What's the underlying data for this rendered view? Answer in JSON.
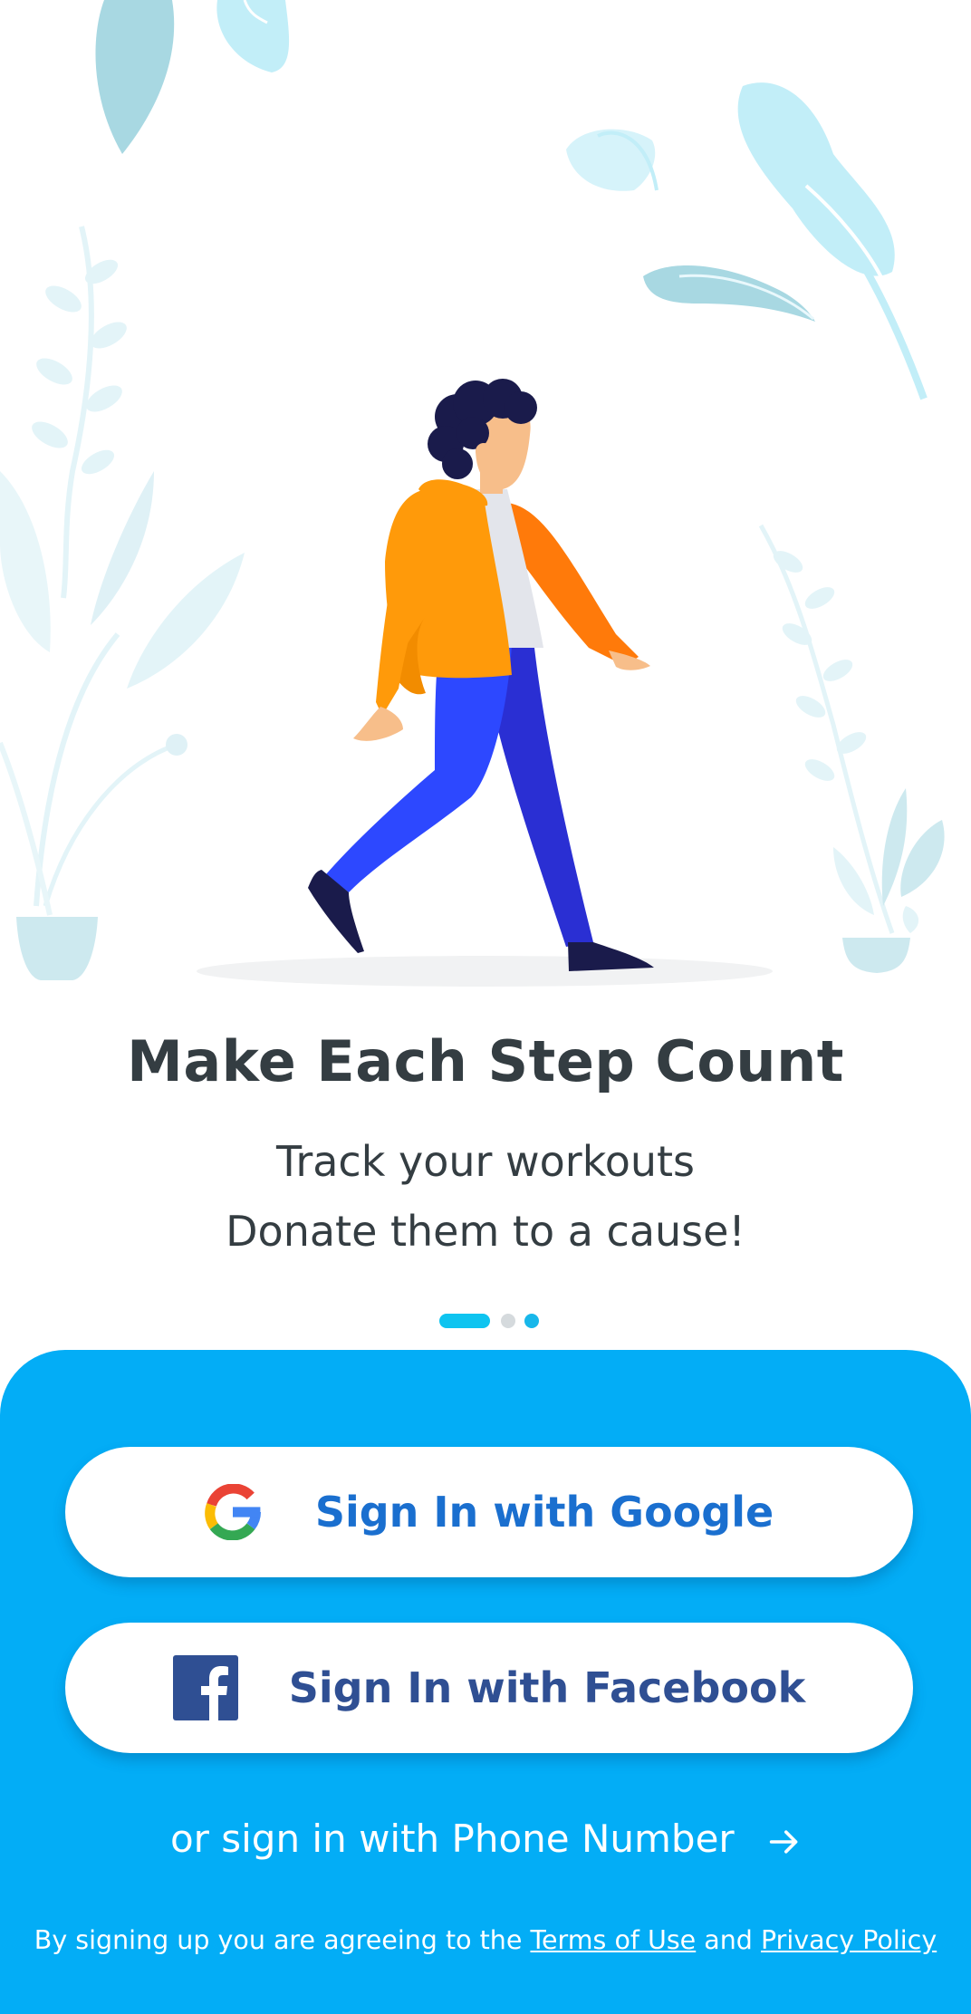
{
  "onboarding": {
    "title": "Make Each Step Count",
    "subtitle_line1": "Track your workouts",
    "subtitle_line2": "Donate them to a cause!",
    "pager": {
      "total": 3,
      "active_index": 0
    }
  },
  "auth": {
    "google_label": "Sign In with Google",
    "facebook_label": "Sign In with Facebook",
    "phone_label": "or sign in with Phone Number",
    "terms_prefix": "By signing up you are agreeing to the",
    "terms_link": "Terms of Use",
    "terms_and": "and",
    "privacy_link": "Privacy Policy"
  },
  "icons": {
    "google": "google-logo-icon",
    "facebook": "facebook-logo-icon",
    "arrow": "arrow-right-icon"
  },
  "colors": {
    "panel": "#03adf6",
    "title_text": "#343d42",
    "google_text": "#1a6fcf",
    "facebook_blue": "#2f4f93",
    "pager_active": "#0ec4f0"
  }
}
